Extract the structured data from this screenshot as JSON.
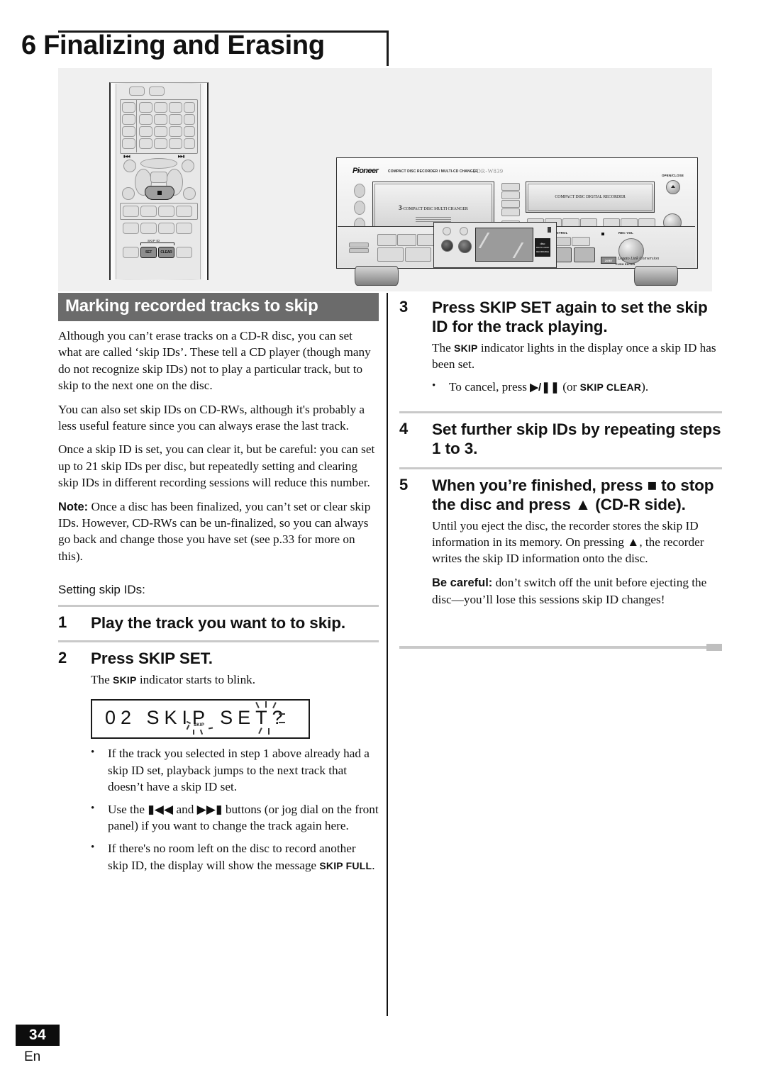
{
  "chapter": {
    "title": "6 Finalizing and Erasing"
  },
  "illustration": {
    "remote": {
      "skip_id_label": "SKIP ID",
      "set_button": "SET",
      "clear_button": "CLEAR",
      "prev_icon": "previous-track-icon",
      "next_icon": "next-track-icon",
      "stop_icon": "stop-icon"
    },
    "deck": {
      "brand": "Pioneer",
      "brand_subtitle": "COMPACT DISC RECORDER / MULTI-CD CHANGER",
      "model": "PDR-W839",
      "changer_tray_label_prefix": "3",
      "changer_tray_label": "-COMPACT DISC MULTI CHANGER",
      "recorder_tray_label": "COMPACT DISC DIGITAL RECORDER",
      "open_close_label": "OPEN/CLOSE",
      "cdr_control_label": "CD-R CONTROL",
      "rec_vol_label": "REC VOL",
      "push_enter_label": "PUSH ENTER",
      "legato_text": "Legato Link Conversion",
      "legato_badge": "24 BIT",
      "cd_logo_line1": "disc",
      "cd_logo_line2": "DIGITAL AUDIO",
      "cd_logo_line3": "RECORDABLE"
    }
  },
  "left_column": {
    "section_heading": "Marking recorded tracks to skip",
    "paragraphs": [
      "Although you can’t erase tracks on a CD-R disc, you can set what are called ‘skip IDs’. These tell a CD player (though many do not recognize skip IDs) not to play a particular track, but to skip to the next one on the disc.",
      "You can also set skip IDs on CD-RWs, although it's probably a less useful feature since you can always erase the last track.",
      "Once a skip ID is set, you can clear it, but be careful: you can set up to 21 skip IDs per disc, but repeatedly setting and clearing skip IDs in different recording sessions will reduce this number."
    ],
    "note_lead": "Note:",
    "note_text": " Once a disc has been finalized, you can’t set or clear skip IDs. However, CD-RWs can be un-finalized, so you can always go back and change those you have set (see p.33 for more on this).",
    "intro_line": "Setting skip IDs:",
    "step1": {
      "num": "1",
      "text": "Play the track you want to to skip."
    },
    "step2": {
      "num": "2",
      "text": "Press SKIP SET.",
      "body_pre": "The ",
      "body_sc": "SKIP",
      "body_post": " indicator starts to blink."
    },
    "lcd": {
      "text": "02  SKIP  SET?",
      "indicator": "SKIP"
    },
    "bullets": [
      "If the track you selected in step 1 above already had a skip ID set, playback jumps to the next track that doesn’t have a skip ID set.",
      "Use the ◀◀ and ▶▶ buttons (or jog dial on the front panel) if you want to change the track again here.",
      "If there's no room left on the disc to record another skip ID, the display will show the message SKIP FULL."
    ],
    "bullet3_pre": "If there's no room left on the disc to record another skip ID, the display will show the message ",
    "bullet3_sc": "SKIP FULL",
    "bullet3_post": ".",
    "bullet2_pre": "Use the ",
    "bullet2_mid": " and ",
    "bullet2_post": " buttons (or jog dial on the front panel) if you want to change the track again here."
  },
  "right_column": {
    "step3": {
      "num": "3",
      "text": "Press SKIP SET again to set the skip ID for the track playing.",
      "body_pre": "The ",
      "body_sc": "SKIP",
      "body_post": " indicator lights in the display once a skip ID has been set.",
      "bullet_pre": "To cancel, press ",
      "bullet_icon": "▶/❚❚",
      "bullet_mid": " (or ",
      "bullet_sc": "SKIP CLEAR",
      "bullet_post": ")."
    },
    "step4": {
      "num": "4",
      "text": "Set further skip IDs by repeating steps 1 to 3."
    },
    "step5": {
      "num": "5",
      "text_pre": "When you’re finished, press ",
      "text_stop": "■",
      "text_mid": " to stop the disc and press ",
      "text_eject": "▲",
      "text_post": " (CD-R side).",
      "body_pre": "Until you eject the disc, the recorder stores the skip ID information in its memory. On pressing ",
      "body_icon": "▲",
      "body_post": ", the recorder writes the skip ID information onto the disc.",
      "care_lead": "Be careful:",
      "care_text": " don’t switch off the unit before ejecting the disc—you’ll lose this sessions skip ID changes!"
    }
  },
  "footer": {
    "page_number": "34",
    "language": "En"
  }
}
